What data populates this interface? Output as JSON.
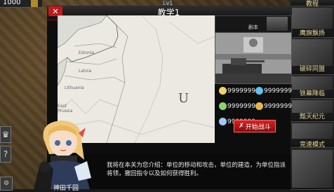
{
  "hud": {
    "resource_value": "1000",
    "level_text": "Lv1"
  },
  "dialog": {
    "title": "教学1",
    "close_icon": "close-icon",
    "mission_label": "剧本",
    "start_button": "开始战斗",
    "text": "我将在本关为您介绍：单位的移动和攻击，单位的建造，为单位指派将领，撤回指令以及如何获得胜利。"
  },
  "tutorial_map": {
    "labels": [
      "Estonia",
      "Latvia",
      "Lithuania",
      "East Prussia",
      "U"
    ]
  },
  "resources": [
    {
      "icon": "coin-icon",
      "color": "#f4d35e",
      "value": "9999999"
    },
    {
      "icon": "gem-icon",
      "color": "#5ec3f4",
      "value": "9999999"
    },
    {
      "icon": "oil-icon",
      "color": "#8bd66b",
      "value": "9999999"
    },
    {
      "icon": "gold-icon",
      "color": "#e6b84a",
      "value": "9999999"
    },
    {
      "icon": "medal-icon",
      "color": "#9ccaff",
      "value": "9999999"
    }
  ],
  "right_menu": [
    {
      "label": "教程"
    },
    {
      "label": "鹰旗飘扬"
    },
    {
      "label": "破碎同盟"
    },
    {
      "label": "铁幕降临"
    },
    {
      "label": "黯灭纪元"
    },
    {
      "label": "竞速模式"
    }
  ],
  "bottom": {
    "back_label": "神田千园"
  }
}
